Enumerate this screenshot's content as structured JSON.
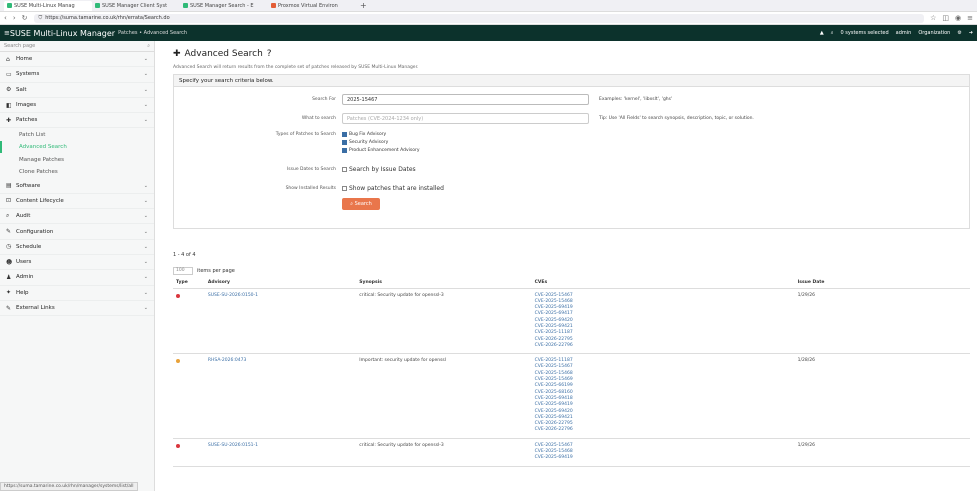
{
  "browser": {
    "tabs": [
      {
        "label": "SUSE Multi-Linux Manag"
      },
      {
        "label": "SUSE Manager Client Syst"
      },
      {
        "label": "SUSE Manager Search - E"
      },
      {
        "label": "Proxmox Virtual Environ"
      }
    ],
    "new_tab": "+",
    "url": "https://suma.tamarine.co.uk/rhn/errata/Search.do",
    "status_url": "https://suma.tamarine.co.uk/rhn/manager/systems/list/all"
  },
  "header": {
    "brand": "SUSE Multi-Linux Manager",
    "breadcrumb": "Patches • Advanced Search",
    "systems_selected": "0 systems selected",
    "user": "admin",
    "org": "Organization"
  },
  "sidebar": {
    "search_placeholder": "Search page",
    "items": [
      {
        "label": "Home",
        "icon": "⌂"
      },
      {
        "label": "Systems",
        "icon": "▭"
      },
      {
        "label": "Salt",
        "icon": "⚙"
      },
      {
        "label": "Images",
        "icon": "◧"
      },
      {
        "label": "Patches",
        "icon": "✚"
      }
    ],
    "subs": [
      {
        "label": "Patch List"
      },
      {
        "label": "Advanced Search"
      },
      {
        "label": "Manage Patches"
      },
      {
        "label": "Clone Patches"
      }
    ],
    "items2": [
      {
        "label": "Software",
        "icon": "▤"
      },
      {
        "label": "Content Lifecycle",
        "icon": "⊡"
      },
      {
        "label": "Audit",
        "icon": "⌕"
      },
      {
        "label": "Configuration",
        "icon": "✎"
      },
      {
        "label": "Schedule",
        "icon": "◷"
      },
      {
        "label": "Users",
        "icon": "☻"
      },
      {
        "label": "Admin",
        "icon": "♟"
      },
      {
        "label": "Help",
        "icon": "✦"
      },
      {
        "label": "External Links",
        "icon": "✎"
      }
    ]
  },
  "page": {
    "title": "Advanced Search",
    "description": "Advanced Search will return results from the complete set of patches released by SUSE Multi-Linux Manager.",
    "criteria_heading": "Specify your search criteria below.",
    "search_for_label": "Search For",
    "search_for_value": "2025-15467",
    "search_for_hint": "Examples: 'kernel', 'libxslt', 'ghs'",
    "what_label": "What to search",
    "what_placeholder": "Patches (CVE-2024-1234 only)",
    "what_hint": "Tip: Use 'All Fields' to search synopsis, description, topic, or solution.",
    "types_label": "Types of Patches to Search",
    "types": [
      {
        "label": "Bug Fix Advisory"
      },
      {
        "label": "Security Advisory"
      },
      {
        "label": "Product Enhancement Advisory"
      }
    ],
    "issue_label": "Issue Dates to Search",
    "issue_cb": "Search by Issue Dates",
    "installed_label": "Show Installed Results",
    "installed_cb": "Show patches that are installed",
    "search_button": "Search",
    "count": "1 - 4 of 4",
    "per_page": "100",
    "per_page_label": "items per page"
  },
  "table": {
    "headers": [
      "Type",
      "Advisory",
      "Synopsis",
      "CVEs",
      "Issue Date"
    ],
    "rows": [
      {
        "advisory": "SUSE-SU-2026:0150-1",
        "synopsis": "critical: Security update for openssl-3",
        "date": "1/29/26",
        "cves": [
          "CVE-2025-15467",
          "CVE-2025-15468",
          "CVE-2025-69419",
          "CVE-2025-69417",
          "CVE-2025-69420",
          "CVE-2025-69421",
          "CVE-2025-11187",
          "CVE-2026-22795",
          "CVE-2026-22796"
        ]
      },
      {
        "advisory": "RHSA-2026:0473",
        "synopsis": "Important: security update for openssl",
        "date": "1/28/26",
        "cves": [
          "CVE-2025-11187",
          "CVE-2025-15467",
          "CVE-2025-15468",
          "CVE-2025-15469",
          "CVE-2025-66199",
          "CVE-2025-68160",
          "CVE-2025-69418",
          "CVE-2025-69419",
          "CVE-2025-69420",
          "CVE-2025-69421",
          "CVE-2026-22795",
          "CVE-2026-22796"
        ]
      },
      {
        "advisory": "SUSE-SU-2026:0151-1",
        "synopsis": "critical: Security update for openssl-3",
        "date": "1/29/26",
        "cves": [
          "CVE-2025-15467",
          "CVE-2025-15468",
          "CVE-2025-69419"
        ]
      }
    ]
  },
  "colors": {
    "header": "#0c322c",
    "accent": "#30ba78",
    "button": "#e9764b",
    "link": "#3a6ea5",
    "critical": "#d9363e",
    "important": "#e8a23a"
  }
}
